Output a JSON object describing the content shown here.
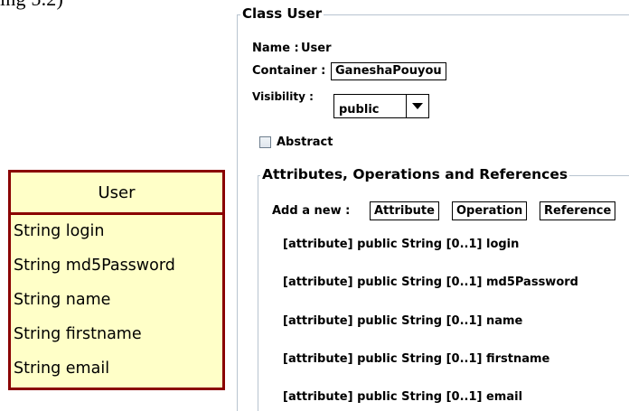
{
  "caption_fragment": "ing 5.2)",
  "uml_class": {
    "name": "User",
    "attributes": [
      "String login",
      "String md5Password",
      "String name",
      "String firstname",
      "String email"
    ]
  },
  "form": {
    "section_title": "Class User",
    "name_label": "Name :",
    "name_value": "User",
    "container_label": "Container :",
    "container_value": "GaneshaPouyou",
    "visibility_label": "Visibility :",
    "visibility_value": "public",
    "abstract_label": "Abstract",
    "abstract_checked": false,
    "sub_section_title": "Attributes, Operations and References",
    "add_label": "Add a new :",
    "buttons": [
      "Attribute",
      "Operation",
      "Reference"
    ],
    "attribute_rows": [
      "[attribute] public String [0..1]  login",
      "[attribute] public String [0..1]  md5Password",
      "[attribute] public String [0..1]  name",
      "[attribute] public String [0..1]  firstname",
      "[attribute] public String [0..1]  email"
    ]
  },
  "colors": {
    "uml_fill": "#ffffc8",
    "uml_border": "#8a0000",
    "fieldset_border": "#b8c4d0"
  }
}
